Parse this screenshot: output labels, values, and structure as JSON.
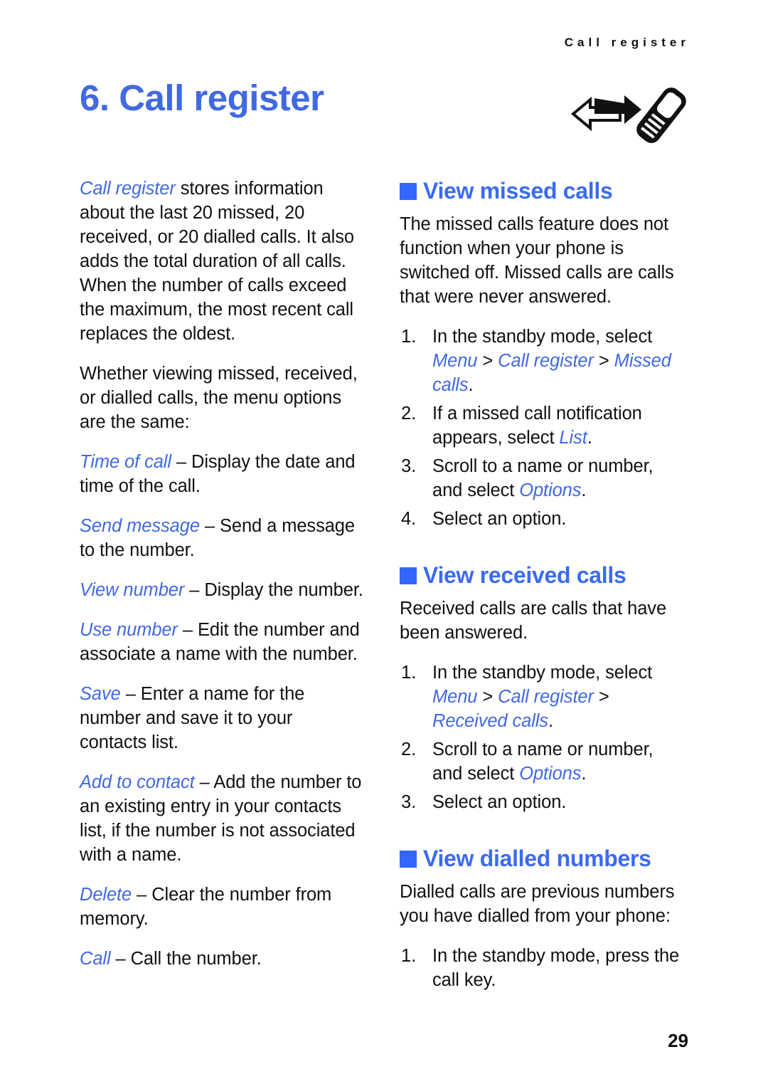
{
  "page": {
    "running_header": "Call register",
    "chapter_title": "6. Call register",
    "page_number": "29",
    "icon_name": "call-register-icon",
    "accent_blue": "#4169E1",
    "heading_blue": "#3366FF"
  },
  "left_column": {
    "intro": {
      "term": "Call register",
      "rest": " stores information about the last 20 missed, 20 received, or 20 dialled calls. It also adds the total duration of all calls. When the number of calls exceed the maximum, the most recent call replaces the oldest."
    },
    "whether": "Whether viewing missed, received, or dialled calls, the menu options are the same:",
    "options": [
      {
        "term": "Time of call",
        "dash": " – ",
        "text": "Display the date and time of the call."
      },
      {
        "term": "Send message",
        "dash": " – ",
        "text": "Send a message to the number."
      },
      {
        "term": "View number",
        "dash": " – ",
        "text": "Display the number."
      },
      {
        "term": "Use number",
        "dash": " – ",
        "text": "Edit the number and associate a name with the number."
      },
      {
        "term": "Save",
        "dash": " – ",
        "text": "Enter a name for the number and save it to your contacts list."
      },
      {
        "term": "Add to contact",
        "dash": " – ",
        "text": "Add the number to an existing entry in your contacts list, if the number is not associated with a name."
      },
      {
        "term": "Delete",
        "dash": " – ",
        "text": "Clear the number from memory."
      },
      {
        "term": "Call",
        "dash": " – ",
        "text": "Call the number."
      }
    ]
  },
  "right_column": {
    "missed": {
      "heading": "View missed calls",
      "intro": "The missed calls feature does not function when your phone is switched off. Missed calls are calls that were never answered.",
      "steps": [
        {
          "num": "1.",
          "pre": "In the standby mode, select ",
          "path": [
            {
              "ui": "Menu"
            },
            {
              "sep": " > "
            },
            {
              "ui": "Call register"
            },
            {
              "sep": " > "
            },
            {
              "ui": "Missed calls"
            }
          ],
          "post": "."
        },
        {
          "num": "2.",
          "pre": "If a missed call notification appears, select ",
          "path": [
            {
              "ui": "List"
            }
          ],
          "post": "."
        },
        {
          "num": "3.",
          "pre": "Scroll to a name or number, and select ",
          "path": [
            {
              "ui": "Options"
            }
          ],
          "post": "."
        },
        {
          "num": "4.",
          "pre": "Select an option.",
          "path": [],
          "post": ""
        }
      ]
    },
    "received": {
      "heading": "View received calls",
      "intro": "Received calls are calls that have been answered.",
      "steps": [
        {
          "num": "1.",
          "pre": "In the standby mode, select ",
          "path": [
            {
              "ui": "Menu"
            },
            {
              "sep": " > "
            },
            {
              "ui": "Call register"
            },
            {
              "sep": " > "
            },
            {
              "ui": "Received calls"
            }
          ],
          "post": "."
        },
        {
          "num": "2.",
          "pre": "Scroll to a name or number, and select ",
          "path": [
            {
              "ui": "Options"
            }
          ],
          "post": "."
        },
        {
          "num": "3.",
          "pre": "Select an option.",
          "path": [],
          "post": ""
        }
      ]
    },
    "dialled": {
      "heading": "View dialled numbers",
      "intro": "Dialled calls are previous numbers you have dialled from your phone:",
      "steps": [
        {
          "num": "1.",
          "pre": "In the standby mode, press the call key.",
          "path": [],
          "post": ""
        }
      ]
    }
  }
}
